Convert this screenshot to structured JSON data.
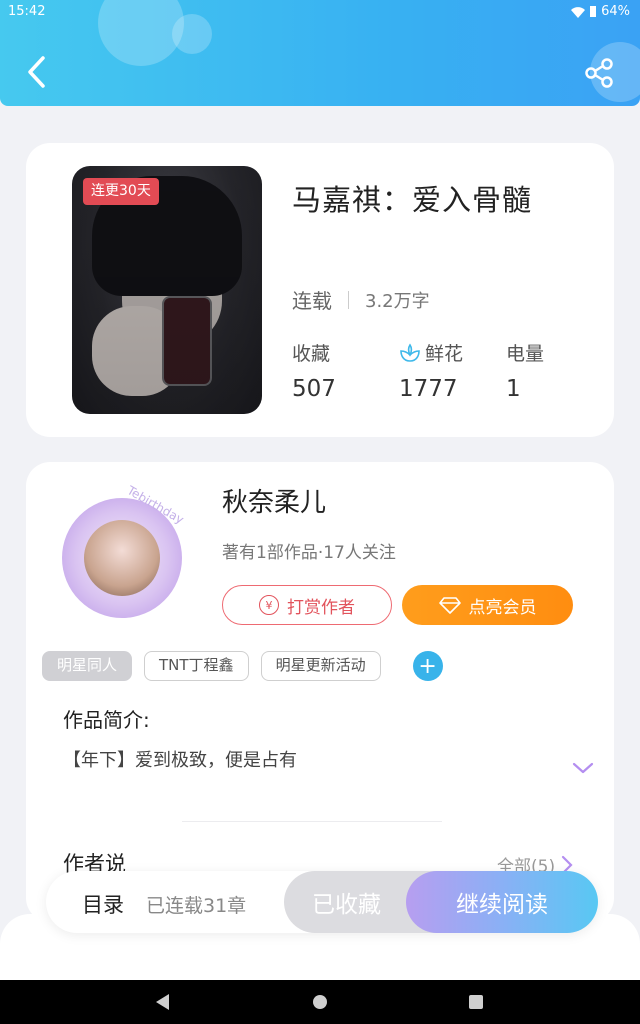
{
  "status_bar": {
    "time": "15:42",
    "battery": "64%"
  },
  "book": {
    "badge": "连更30天",
    "title": "马嘉祺：爱入骨髓",
    "state": "连载",
    "words": "3.2万字",
    "stats": [
      {
        "label": "收藏",
        "value": "507"
      },
      {
        "label": "鲜花",
        "value": "1777"
      },
      {
        "label": "电量",
        "value": "1"
      }
    ]
  },
  "author": {
    "name": "秋奈柔儿",
    "desc": "著有1部作品·17人关注",
    "avatar_text": "Tebirthday",
    "tip_button": "打赏作者",
    "vip_button": "点亮会员"
  },
  "tags": [
    "明星同人",
    "TNT丁程鑫",
    "明星更新活动"
  ],
  "intro": {
    "title": "作品简介:",
    "text": "【年下】爱到极致，便是占有"
  },
  "author_say": {
    "title": "作者说",
    "all": "全部(5)"
  },
  "action_bar": {
    "toc": "目录",
    "chapters": "已连载31章",
    "favorited": "已收藏",
    "continue": "继续阅读"
  },
  "colors": {
    "header_start": "#46c9ef",
    "header_end": "#3aa2f4",
    "badge": "#e24b54",
    "tip": "#e2535c",
    "vip": "#ff9d1c",
    "tag_add": "#38b3ea"
  }
}
